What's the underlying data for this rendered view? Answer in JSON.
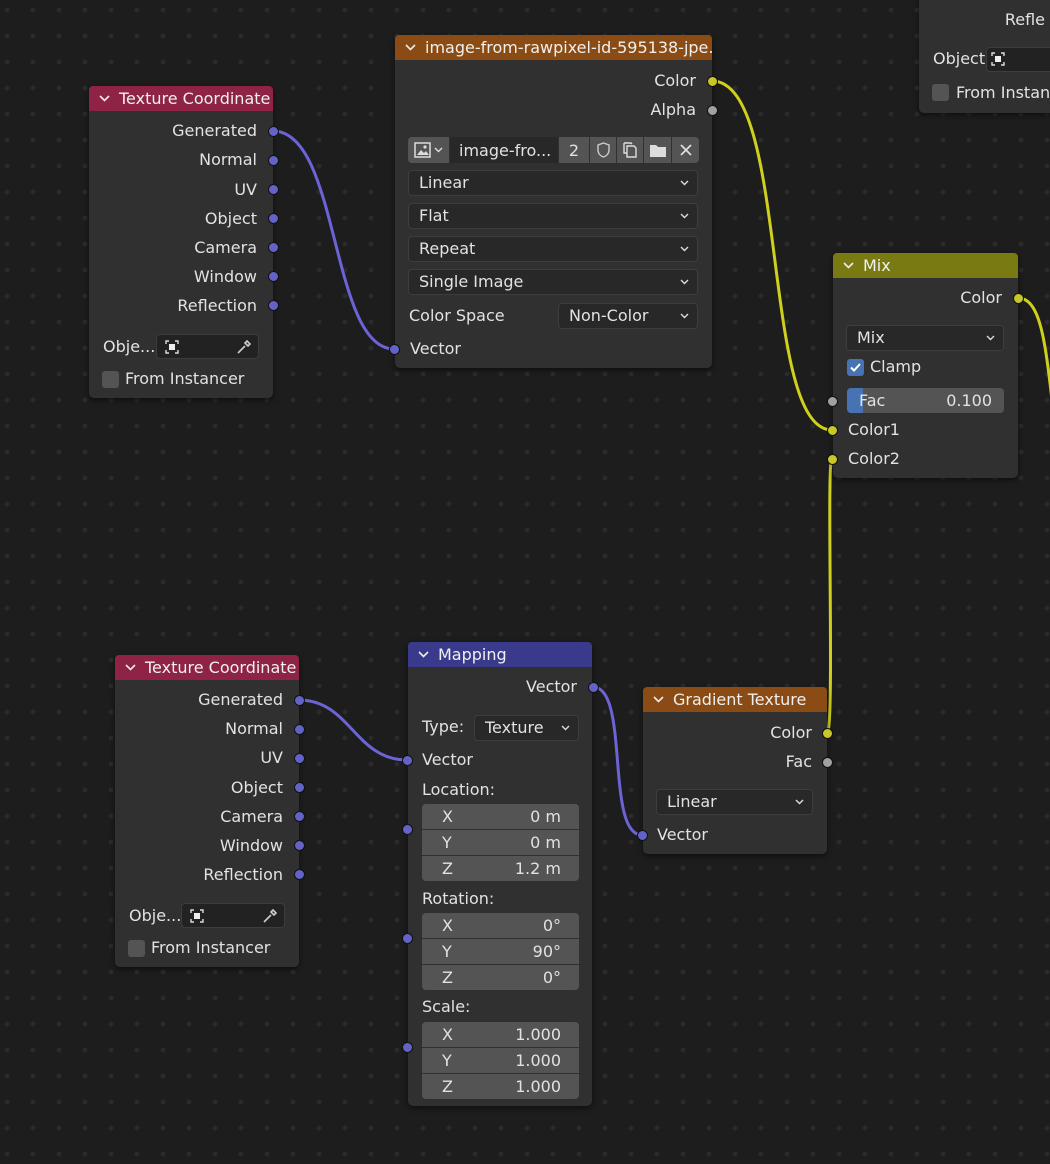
{
  "colors": {
    "background": "#1d1d1d",
    "node_body": "#303030",
    "texcoord_header": "#8e2345",
    "image_header": "#8a4c14",
    "mix_header": "#7a7a12",
    "mapping_header": "#3a3a8c",
    "gradient_header": "#8a4c14",
    "vector_socket": "#6363c7",
    "color_socket": "#c7c729",
    "float_socket": "#a1a1a1",
    "wire_vector": "#6b63d6",
    "wire_color": "#cfcf1e",
    "checkbox_on": "#4772b3"
  },
  "texcoord1": {
    "title": "Texture Coordinate",
    "outputs": [
      "Generated",
      "Normal",
      "UV",
      "Object",
      "Camera",
      "Window",
      "Reflection"
    ],
    "object_label": "Obje...",
    "from_instancer": "From Instancer"
  },
  "image_node": {
    "title": "image-from-rawpixel-id-595138-jpe...",
    "out_color": "Color",
    "out_alpha": "Alpha",
    "image_name": "image-fro...",
    "users": "2",
    "interpolation": "Linear",
    "projection": "Flat",
    "extension": "Repeat",
    "source": "Single Image",
    "colorspace_label": "Color Space",
    "colorspace_value": "Non-Color",
    "in_vector": "Vector"
  },
  "mix_node": {
    "title": "Mix",
    "out_color": "Color",
    "blend": "Mix",
    "clamp": "Clamp",
    "clamp_checked": true,
    "fac_label": "Fac",
    "fac_value": "0.100",
    "fac_fraction": 0.1,
    "color1": "Color1",
    "color2": "Color2"
  },
  "partial_node": {
    "reflection": "Refle",
    "object_label": "Object:",
    "from_instancer": "From Instanc"
  },
  "texcoord2": {
    "title": "Texture Coordinate",
    "outputs": [
      "Generated",
      "Normal",
      "UV",
      "Object",
      "Camera",
      "Window",
      "Reflection"
    ],
    "object_label": "Obje...",
    "from_instancer": "From Instancer"
  },
  "mapping": {
    "title": "Mapping",
    "out_vector": "Vector",
    "type_label": "Type:",
    "type_value": "Texture",
    "in_vector": "Vector",
    "location_label": "Location:",
    "location": [
      {
        "axis": "X",
        "value": "0 m"
      },
      {
        "axis": "Y",
        "value": "0 m"
      },
      {
        "axis": "Z",
        "value": "1.2 m"
      }
    ],
    "rotation_label": "Rotation:",
    "rotation": [
      {
        "axis": "X",
        "value": "0°"
      },
      {
        "axis": "Y",
        "value": "90°"
      },
      {
        "axis": "Z",
        "value": "0°"
      }
    ],
    "scale_label": "Scale:",
    "scale": [
      {
        "axis": "X",
        "value": "1.000"
      },
      {
        "axis": "Y",
        "value": "1.000"
      },
      {
        "axis": "Z",
        "value": "1.000"
      }
    ]
  },
  "gradient": {
    "title": "Gradient Texture",
    "out_color": "Color",
    "out_fac": "Fac",
    "type": "Linear",
    "in_vector": "Vector"
  }
}
